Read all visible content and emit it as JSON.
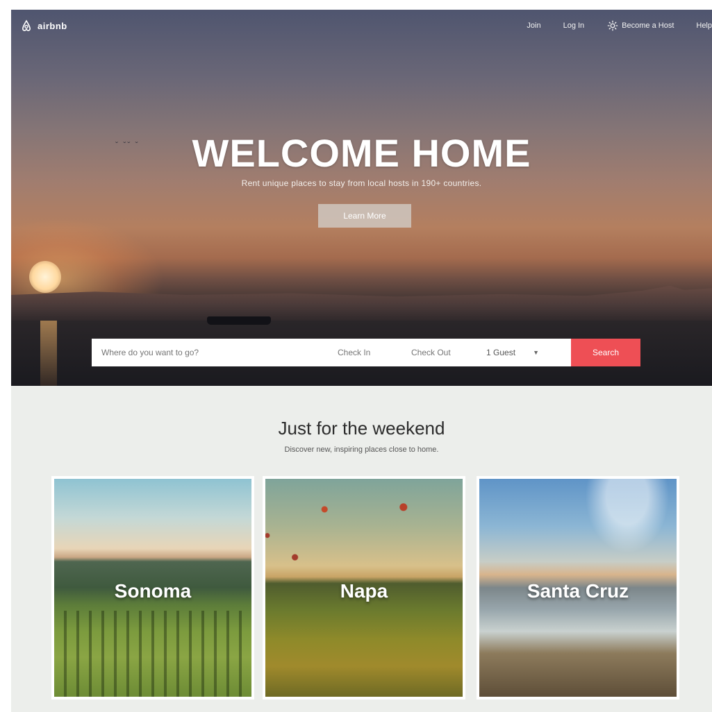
{
  "brand": {
    "name": "airbnb"
  },
  "nav": {
    "items": [
      {
        "label": "Join"
      },
      {
        "label": "Log In"
      },
      {
        "label": "Become a Host"
      },
      {
        "label": "Help"
      }
    ]
  },
  "hero": {
    "title": "WELCOME HOME",
    "subtitle": "Rent unique places to stay from local hosts in 190+ countries.",
    "button_label": "Learn More"
  },
  "search": {
    "where_placeholder": "Where do you want to go?",
    "checkin_placeholder": "Check In",
    "checkout_placeholder": "Check Out",
    "guests_value": "1 Guest",
    "button_label": "Search"
  },
  "section": {
    "title": "Just for the weekend",
    "subtitle": "Discover new, inspiring places close to home."
  },
  "cards": [
    {
      "title": "Sonoma"
    },
    {
      "title": "Napa"
    },
    {
      "title": "Santa Cruz"
    }
  ],
  "colors": {
    "accent": "#ee4f55",
    "page_bg": "#eceeeb"
  },
  "icons": {
    "logo": "airbnb-logo-icon",
    "host": "gear-icon",
    "guests_caret": "caret-down-icon"
  }
}
